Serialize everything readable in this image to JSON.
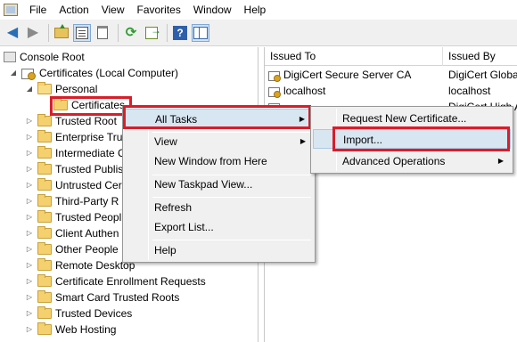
{
  "menubar": [
    "File",
    "Action",
    "View",
    "Favorites",
    "Window",
    "Help"
  ],
  "tree": {
    "root": "Console Root",
    "computer": "Certificates (Local Computer)",
    "personal": "Personal",
    "certificates": "Certificates",
    "items": [
      "Trusted Root",
      "Enterprise Tru",
      "Intermediate C",
      "Trusted Publis",
      "Untrusted Cer",
      "Third-Party R",
      "Trusted Peopl",
      "Client Authen",
      "Other People",
      "Remote Desktop",
      "Certificate Enrollment Requests",
      "Smart Card Trusted Roots",
      "Trusted Devices",
      "Web Hosting"
    ]
  },
  "list": {
    "columns": [
      "Issued To",
      "Issued By"
    ],
    "rows": [
      {
        "issued_to": "DigiCert Secure Server CA",
        "issued_by": "DigiCert Globa"
      },
      {
        "issued_to": "localhost",
        "issued_by": "localhost"
      },
      {
        "issued_to": "",
        "issued_by": "DigiCert High A"
      }
    ]
  },
  "context_menu": {
    "all_tasks": "All Tasks",
    "view": "View",
    "new_window": "New Window from Here",
    "new_taskpad": "New Taskpad View...",
    "refresh": "Refresh",
    "export_list": "Export List...",
    "help": "Help"
  },
  "submenu": {
    "request_new": "Request New Certificate...",
    "import": "Import...",
    "advanced": "Advanced Operations"
  },
  "colors": {
    "highlight_red": "#d81e2a",
    "menu_hover": "#d8e6f2"
  }
}
